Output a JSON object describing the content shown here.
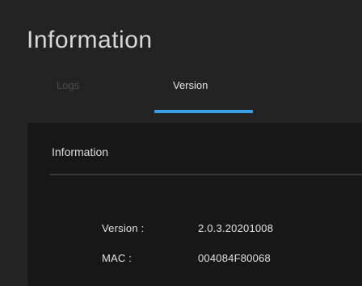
{
  "header": {
    "title": "Information"
  },
  "tabs": [
    {
      "label": "Logs",
      "active": false
    },
    {
      "label": "Version",
      "active": true
    }
  ],
  "colors": {
    "accent": "#3aa0e6",
    "background": "#232323",
    "panel_background": "#171717"
  },
  "panel": {
    "title": "Information",
    "rows": [
      {
        "label": "Version :",
        "value": "2.0.3.20201008"
      },
      {
        "label": "MAC :",
        "value": "004084F80068"
      }
    ]
  }
}
